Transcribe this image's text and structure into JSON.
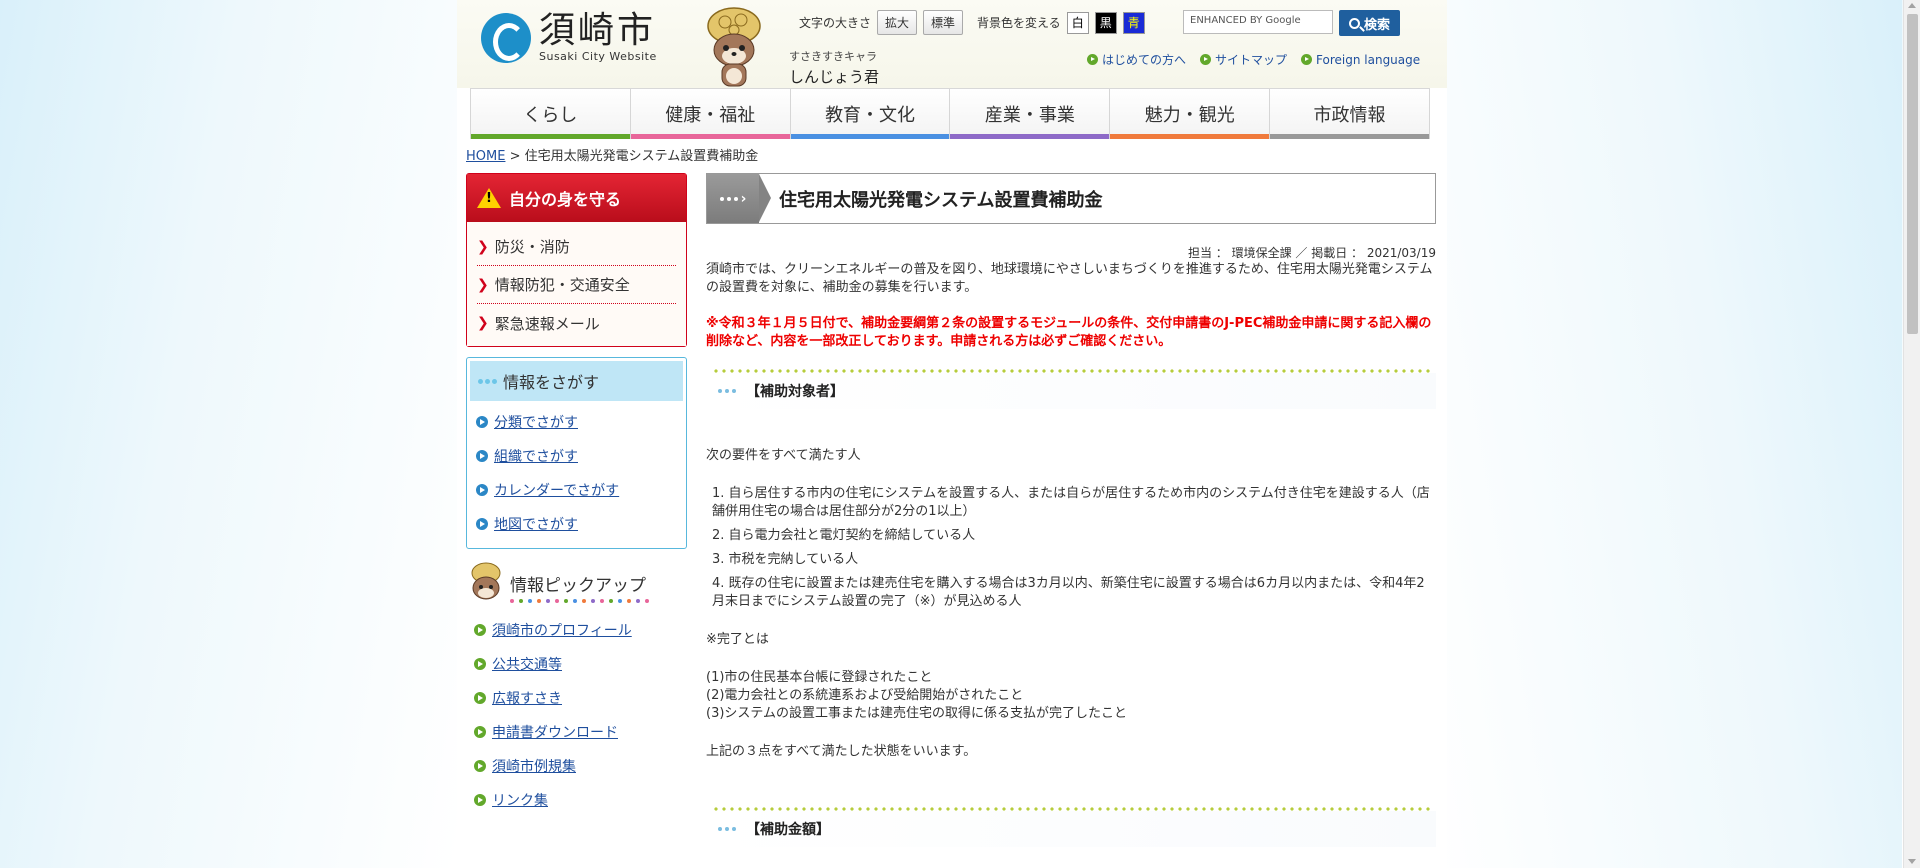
{
  "site": {
    "logo_title": "須崎市",
    "logo_sub": "Susaki City Website",
    "mascot_small": "すさきすきキャラ",
    "mascot_name": "しんじょう君"
  },
  "tools": {
    "font_size_label": "文字の大きさ",
    "enlarge": "拡大",
    "standard": "標準",
    "bg_label": "背景色を変える",
    "bg_white": "白",
    "bg_black": "黒",
    "bg_blue": "青",
    "search_placeholder": "ENHANCED BY Google",
    "search_button": "検索"
  },
  "quicklinks": [
    "はじめての方へ",
    "サイトマップ",
    "Foreign language"
  ],
  "nav": [
    {
      "label": "くらし",
      "color": "#62a82b"
    },
    {
      "label": "健康・福祉",
      "color": "#e8669a"
    },
    {
      "label": "教育・文化",
      "color": "#4a90e2"
    },
    {
      "label": "産業・事業",
      "color": "#8e6ac8"
    },
    {
      "label": "魅力・観光",
      "color": "#f07a3c"
    },
    {
      "label": "市政情報",
      "color": "#999999"
    }
  ],
  "breadcrumb": {
    "home": "HOME",
    "sep": ">",
    "current": "住宅用太陽光発電システム設置費補助金"
  },
  "sidebar": {
    "emergency_title": "自分の身を守る",
    "emergency_items": [
      "防災・消防",
      "情報防犯・交通安全",
      "緊急速報メール"
    ],
    "search_title": "情報をさがす",
    "search_items": [
      "分類でさがす",
      "組織でさがす",
      "カレンダーでさがす",
      "地図でさがす"
    ],
    "pickup_title": "情報ピックアップ",
    "pickup_items": [
      "須崎市のプロフィール",
      "公共交通等",
      "広報すさき",
      "申請書ダウンロード",
      "須崎市例規集",
      "リンク集"
    ]
  },
  "main": {
    "title": "住宅用太陽光発電システム設置費補助金",
    "meta": "担当 ： 環境保全課 ／ 掲載日 ： 2021/03/19",
    "intro": "須崎市では、クリーンエネルギーの普及を図り、地球環境にやさしいまちづくりを推進するため、住宅用太陽光発電システムの設置費を対象に、補助金の募集を行います。",
    "notice": "※令和３年１月５日付で、補助金要綱第２条の設置するモジュールの条件、交付申請書のJ-PEC補助金申請に関する記入欄の削除など、内容を一部改正しております。申請される方は必ずご確認ください。",
    "section1": "【補助対象者】",
    "req_intro": "次の要件をすべて満たす人",
    "reqs": [
      "1. 自ら居住する市内の住宅にシステムを設置する人、または自らが居住するため市内のシステム付き住宅を建設する人（店舗併用住宅の場合は居住部分が2分の1以上）",
      "2. 自ら電力会社と電灯契約を締結している人",
      "3. 市税を完納している人",
      "4. 既存の住宅に設置または建売住宅を購入する場合は3カ月以内、新築住宅に設置する場合は6カ月以内または、令和4年2月末日までにシステム設置の完了（※）が見込める人"
    ],
    "complete_label": "※完了とは",
    "completes": [
      "(1)市の住民基本台帳に登録されたこと",
      "(2)電力会社との系統連系および受給開始がされたこと",
      "(3)システムの設置工事または建売住宅の取得に係る支払が完了したこと"
    ],
    "complete_summary": "上記の３点をすべて満たした状態をいいます。",
    "section2": "【補助金額】"
  }
}
